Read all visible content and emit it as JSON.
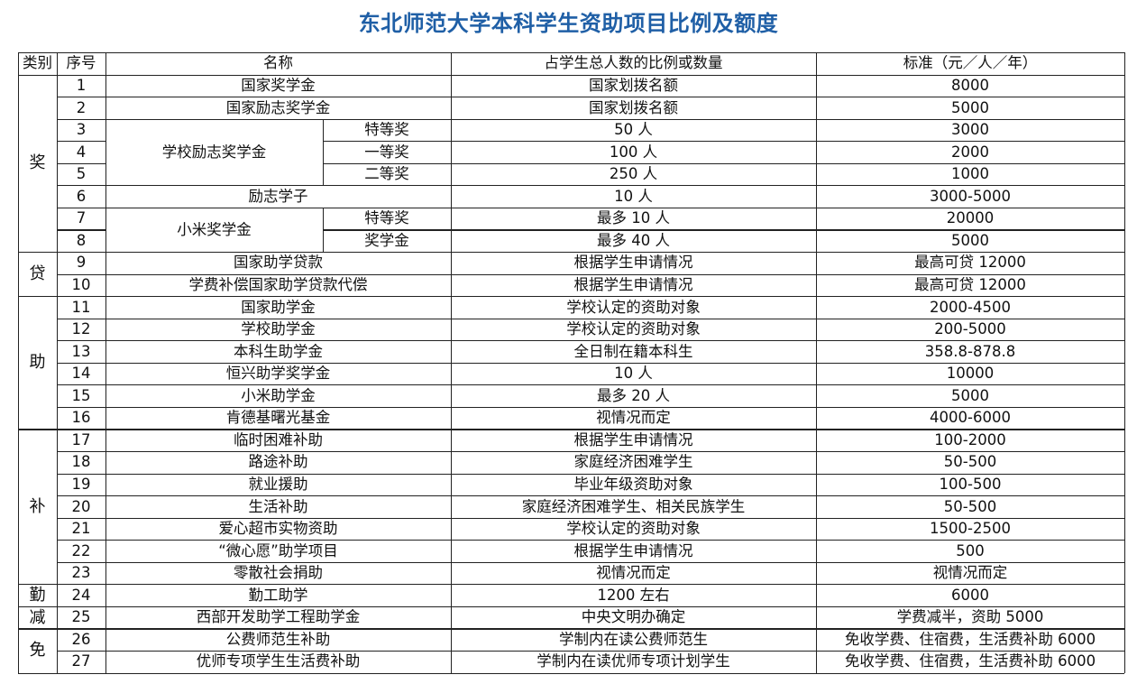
{
  "title": "东北师范大学本科学生资助项目比例及额度",
  "headers": {
    "category": "类别",
    "seq": "序号",
    "name": "名称",
    "ratio": "占学生总人数的比例或数量",
    "standard": "标准（元／人／年）"
  },
  "categories": [
    {
      "label": "奖",
      "first": 1,
      "last": 8
    },
    {
      "label": "贷",
      "first": 9,
      "last": 10
    },
    {
      "label": "助",
      "first": 11,
      "last": 16
    },
    {
      "label": "补",
      "first": 17,
      "last": 23
    },
    {
      "label": "勤",
      "first": 24,
      "last": 24
    },
    {
      "label": "减",
      "first": 25,
      "last": 25
    },
    {
      "label": "免",
      "first": 26,
      "last": 27
    }
  ],
  "groups": [
    {
      "name": "学校励志奖学金",
      "first": 3,
      "last": 5
    },
    {
      "name": "小米奖学金",
      "first": 7,
      "last": 8
    }
  ],
  "rows": [
    {
      "seq": "1",
      "name": "国家奖学金",
      "ratio": "国家划拨名额",
      "standard": "8000"
    },
    {
      "seq": "2",
      "name": "国家励志奖学金",
      "ratio": "国家划拨名额",
      "standard": "5000"
    },
    {
      "seq": "3",
      "sub": "特等奖",
      "ratio": "50 人",
      "standard": "3000"
    },
    {
      "seq": "4",
      "sub": "一等奖",
      "ratio": "100 人",
      "standard": "2000"
    },
    {
      "seq": "5",
      "sub": "二等奖",
      "ratio": "250 人",
      "standard": "1000"
    },
    {
      "seq": "6",
      "name": "励志学子",
      "ratio": "10 人",
      "standard": "3000-5000"
    },
    {
      "seq": "7",
      "sub": "特等奖",
      "ratio": "最多 10 人",
      "standard": "20000"
    },
    {
      "seq": "8",
      "sub": "奖学金",
      "ratio": "最多 40 人",
      "standard": "5000"
    },
    {
      "seq": "9",
      "name": "国家助学贷款",
      "ratio": "根据学生申请情况",
      "standard": "最高可贷 12000"
    },
    {
      "seq": "10",
      "name": "学费补偿国家助学贷款代偿",
      "ratio": "根据学生申请情况",
      "standard": "最高可贷 12000"
    },
    {
      "seq": "11",
      "name": "国家助学金",
      "ratio": "学校认定的资助对象",
      "standard": "2000-4500"
    },
    {
      "seq": "12",
      "name": "学校助学金",
      "ratio": "学校认定的资助对象",
      "standard": "200-5000"
    },
    {
      "seq": "13",
      "name": "本科生助学金",
      "ratio": "全日制在籍本科生",
      "standard": "358.8-878.8"
    },
    {
      "seq": "14",
      "name": "恒兴助学奖学金",
      "ratio": "10 人",
      "standard": "10000"
    },
    {
      "seq": "15",
      "name": "小米助学金",
      "ratio": "最多 20 人",
      "standard": "5000"
    },
    {
      "seq": "16",
      "name": "肯德基曙光基金",
      "ratio": "视情况而定",
      "standard": "4000-6000"
    },
    {
      "seq": "17",
      "name": "临时困难补助",
      "ratio": "根据学生申请情况",
      "standard": "100-2000"
    },
    {
      "seq": "18",
      "name": "路途补助",
      "ratio": "家庭经济困难学生",
      "standard": "50-500"
    },
    {
      "seq": "19",
      "name": "就业援助",
      "ratio": "毕业年级资助对象",
      "standard": "100-500"
    },
    {
      "seq": "20",
      "name": "生活补助",
      "ratio": "家庭经济困难学生、相关民族学生",
      "standard": "50-500"
    },
    {
      "seq": "21",
      "name": "爱心超市实物资助",
      "ratio": "学校认定的资助对象",
      "standard": "1500-2500"
    },
    {
      "seq": "22",
      "name": "“微心愿”助学项目",
      "ratio": "根据学生申请情况",
      "standard": "500"
    },
    {
      "seq": "23",
      "name": "零散社会捐助",
      "ratio": "视情况而定",
      "standard": "视情况而定"
    },
    {
      "seq": "24",
      "name": "勤工助学",
      "ratio": "1200 左右",
      "standard": "6000"
    },
    {
      "seq": "25",
      "name": "西部开发助学工程助学金",
      "ratio": "中央文明办确定",
      "standard": "学费减半，资助 5000"
    },
    {
      "seq": "26",
      "name": "公费师范生补助",
      "ratio": "学制内在读公费师范生",
      "standard": "免收学费、住宿费，生活费补助 6000"
    },
    {
      "seq": "27",
      "name": "优师专项学生生活费补助",
      "ratio": "学制内在读优师专项计划学生",
      "standard": "免收学费、住宿费，生活费补助 6000"
    }
  ]
}
